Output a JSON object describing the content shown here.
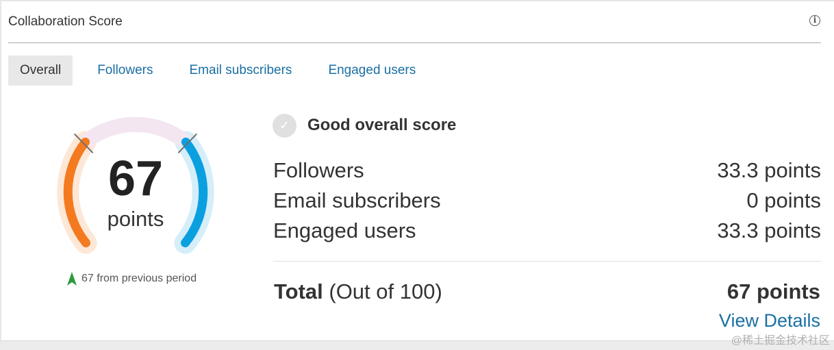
{
  "card": {
    "title": "Collaboration Score",
    "info_icon": "info-icon"
  },
  "tabs": [
    {
      "label": "Overall",
      "active": true
    },
    {
      "label": "Followers",
      "active": false
    },
    {
      "label": "Email subscribers",
      "active": false
    },
    {
      "label": "Engaged users",
      "active": false
    }
  ],
  "gauge": {
    "value": "67",
    "unit": "points",
    "colors": {
      "low": "#f47a20",
      "mid": "#f3e6f1",
      "high": "#0aa0df"
    },
    "trend_icon": "arrow-up-icon",
    "trend_text": "67 from previous period"
  },
  "status": {
    "icon": "check-icon",
    "text": "Good overall score"
  },
  "breakdown": [
    {
      "label": "Followers",
      "value": "33.3 points"
    },
    {
      "label": "Email subscribers",
      "value": "0 points"
    },
    {
      "label": "Engaged users",
      "value": "33.3 points"
    }
  ],
  "total": {
    "label": "Total",
    "note": "(Out of 100)",
    "value": "67 points"
  },
  "links": {
    "view_details": "View Details"
  },
  "watermark": "@稀土掘金技术社区",
  "colors": {
    "link": "#1a6fa3",
    "trend_up": "#2e9a3c"
  }
}
